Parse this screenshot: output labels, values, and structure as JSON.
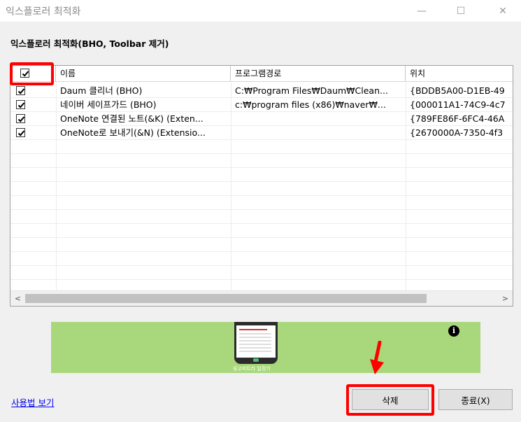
{
  "window": {
    "title": "익스플로러 최적화",
    "minimize": "—",
    "maximize": "☐",
    "close": "✕"
  },
  "heading": "익스플로러 최적화(BHO, Toolbar 제거)",
  "table": {
    "columns": [
      "이름",
      "프로그램경로",
      "위치"
    ],
    "select_all_checked": true,
    "rows": [
      {
        "checked": true,
        "name": "Daum 클리너 (BHO)",
        "path": "C:₩Program Files₩Daum₩Clean...",
        "location": "{BDDB5A00-D1EB-49"
      },
      {
        "checked": true,
        "name": "네이버 세이프가드 (BHO)",
        "path": "c:₩program files (x86)₩naver₩...",
        "location": "{000011A1-74C9-4c7"
      },
      {
        "checked": true,
        "name": "OneNote 연결된 노트(&K) (Exten...",
        "path": "",
        "location": "{789FE86F-6FC4-46A"
      },
      {
        "checked": true,
        "name": "OneNote로 보내기(&N) (Extensio...",
        "path": "",
        "location": "{2670000A-7350-4f3"
      }
    ]
  },
  "scrollbar": {
    "left": "<",
    "right": ">"
  },
  "ad": {
    "caption": "링고피트라 일정기"
  },
  "links": {
    "help": "사용법 보기"
  },
  "buttons": {
    "delete": "삭제",
    "close": "종료(X)"
  },
  "colors": {
    "highlight": "#ff0000",
    "ad_background": "#a8d87b"
  }
}
